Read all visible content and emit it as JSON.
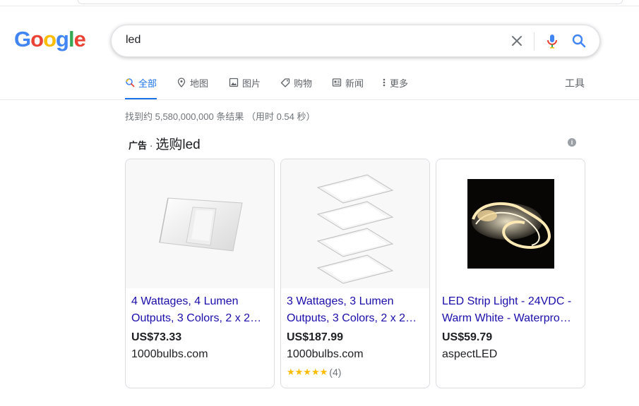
{
  "logo": {
    "letters": [
      {
        "char": "G",
        "color": "#4285F4"
      },
      {
        "char": "o",
        "color": "#EA4335"
      },
      {
        "char": "o",
        "color": "#FBBC05"
      },
      {
        "char": "g",
        "color": "#4285F4"
      },
      {
        "char": "l",
        "color": "#34A853"
      },
      {
        "char": "e",
        "color": "#EA4335"
      }
    ]
  },
  "search": {
    "query": "led"
  },
  "tabs": [
    {
      "label": "全部",
      "icon": "search-icon",
      "active": true
    },
    {
      "label": "地图",
      "icon": "map-pin-icon",
      "active": false
    },
    {
      "label": "图片",
      "icon": "image-icon",
      "active": false
    },
    {
      "label": "购物",
      "icon": "tag-icon",
      "active": false
    },
    {
      "label": "新闻",
      "icon": "news-icon",
      "active": false
    },
    {
      "label": "更多",
      "icon": "more-vertical-icon",
      "active": false
    }
  ],
  "tools_label": "工具",
  "result_stats": "找到约 5,580,000,000 条结果 （用时 0.54 秒）",
  "ads": {
    "ad_label": "广告",
    "separator": "·",
    "title": "选购led",
    "products": [
      {
        "name_line1": "4 Wattages, 4 Lumen",
        "name_line2": "Outputs, 3 Colors, 2 x 2…",
        "price": "US$73.33",
        "seller": "1000bulbs.com",
        "stars": "",
        "rating_count": ""
      },
      {
        "name_line1": "3 Wattages, 3 Lumen",
        "name_line2": "Outputs, 3 Colors, 2 x 2…",
        "price": "US$187.99",
        "seller": "1000bulbs.com",
        "stars": "★★★★★",
        "rating_count": "(4)"
      },
      {
        "name_line1": "LED Strip Light - 24VDC -",
        "name_line2": "Warm White - Waterproo…",
        "price": "US$59.79",
        "seller": "aspectLED",
        "stars": "",
        "rating_count": ""
      }
    ]
  },
  "colors": {
    "accent": "#1a73e8",
    "link": "#1a0dab",
    "star": "#fbbc04"
  }
}
